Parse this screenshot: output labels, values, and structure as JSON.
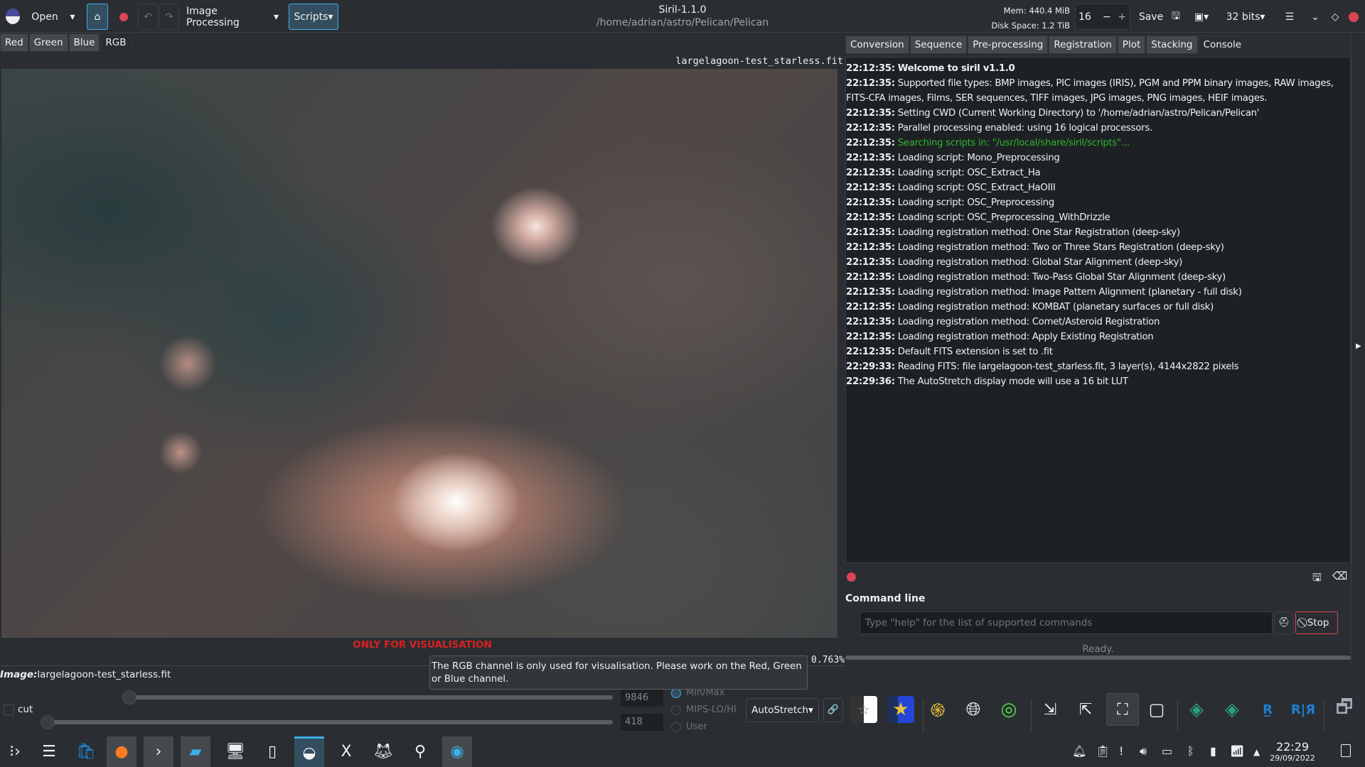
{
  "window": {
    "title": "Siril-1.1.0",
    "path": "/home/adrian/astro/Pelican/Pelican"
  },
  "toolbar": {
    "open": "Open",
    "image_processing": "Image Processing",
    "scripts": "Scripts",
    "mem": "Mem: 440.4 MiB",
    "disk": "Disk Space: 1.2 TiB",
    "threads": "16",
    "save": "Save",
    "bits": "32 bits"
  },
  "channel_tabs": [
    {
      "label": "Red"
    },
    {
      "label": "Green"
    },
    {
      "label": "Blue"
    },
    {
      "label": "RGB",
      "active": true
    }
  ],
  "viewer": {
    "filename": "largelagoon-test_starless.fit",
    "warning": "ONLY FOR VISUALISATION",
    "zoom": "0.763%",
    "image_label": "Image:",
    "image_name": "largelagoon-test_starless.fit"
  },
  "tooltip": "The RGB channel is only used for visualisation. Please work on the Red, Green or Blue channel.",
  "display": {
    "cut_label": "cut",
    "high_value": "9846",
    "low_value": "418",
    "high_fraction": 0.15,
    "low_fraction": 0.0,
    "modes": [
      "Min/Max",
      "MIPS-LO/HI",
      "User"
    ],
    "selected_mode": "Min/Max",
    "stretch": "AutoStretch"
  },
  "right_tabs": [
    {
      "label": "Conversion"
    },
    {
      "label": "Sequence"
    },
    {
      "label": "Pre-processing"
    },
    {
      "label": "Registration"
    },
    {
      "label": "Plot"
    },
    {
      "label": "Stacking"
    },
    {
      "label": "Console",
      "active": true
    }
  ],
  "console": [
    {
      "t": "22:12:35:",
      "m": "Welcome to siril v1.1.0",
      "style": "bold"
    },
    {
      "t": "22:12:35:",
      "m": "Supported file types: BMP images, PIC images (IRIS), PGM and PPM binary images, RAW images, FITS-CFA images, Films, SER sequences, TIFF images, JPG images, PNG images, HEIF images."
    },
    {
      "t": "22:12:35:",
      "m": "Setting CWD (Current Working Directory) to '/home/adrian/astro/Pelican/Pelican'"
    },
    {
      "t": "22:12:35:",
      "m": "Parallel processing enabled: using 16 logical processors."
    },
    {
      "t": "22:12:35:",
      "m": "Searching scripts in: \"/usr/local/share/siril/scripts\"...",
      "style": "green"
    },
    {
      "t": "22:12:35:",
      "m": "Loading script: Mono_Preprocessing"
    },
    {
      "t": "22:12:35:",
      "m": "Loading script: OSC_Extract_Ha"
    },
    {
      "t": "22:12:35:",
      "m": "Loading script: OSC_Extract_HaOIII"
    },
    {
      "t": "22:12:35:",
      "m": "Loading script: OSC_Preprocessing"
    },
    {
      "t": "22:12:35:",
      "m": "Loading script: OSC_Preprocessing_WithDrizzle"
    },
    {
      "t": "22:12:35:",
      "m": "Loading registration method: One Star Registration (deep-sky)"
    },
    {
      "t": "22:12:35:",
      "m": "Loading registration method: Two or Three Stars Registration (deep-sky)"
    },
    {
      "t": "22:12:35:",
      "m": "Loading registration method: Global Star Alignment (deep-sky)"
    },
    {
      "t": "22:12:35:",
      "m": "Loading registration method: Two-Pass Global Star Alignment (deep-sky)"
    },
    {
      "t": "22:12:35:",
      "m": "Loading registration method: Image Pattern Alignment (planetary - full disk)"
    },
    {
      "t": "22:12:35:",
      "m": "Loading registration method: KOMBAT (planetary surfaces or full disk)"
    },
    {
      "t": "22:12:35:",
      "m": "Loading registration method: Comet/Asteroid Registration"
    },
    {
      "t": "22:12:35:",
      "m": "Loading registration method: Apply Existing Registration"
    },
    {
      "t": "22:12:35:",
      "m": "Default FITS extension is set to .fit"
    },
    {
      "t": "22:29:33:",
      "m": "Reading FITS: file largelagoon-test_starless.fit, 3 layer(s), 4144x2822 pixels"
    },
    {
      "t": "22:29:36:",
      "m": "The AutoStretch display mode will use a 16 bit LUT"
    }
  ],
  "command": {
    "label": "Command line",
    "placeholder": "Type \"help\" for the list of supported commands",
    "stop": "Stop",
    "status": "Ready.",
    "progress": 0
  },
  "clock": {
    "time": "22:29",
    "date": "29/09/2022"
  },
  "colors": {
    "accent": "#3daee9",
    "warning": "#da2020",
    "green_log": "#2fb52f"
  }
}
